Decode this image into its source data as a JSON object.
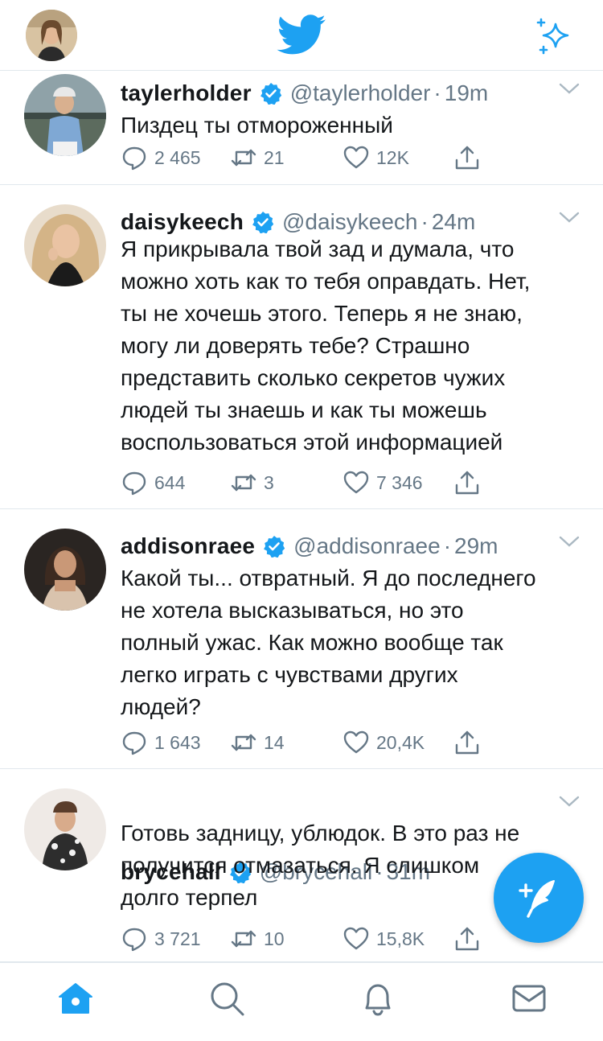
{
  "colors": {
    "accent": "#1da1f2",
    "secondary_text": "#657786",
    "divider": "#e1e8ed"
  },
  "header": {
    "logo_icon": "twitter-bird-icon",
    "sparkle_icon": "sparkle-icon",
    "avatar_icon": "profile-avatar"
  },
  "tweets": [
    {
      "name": "taylerholder",
      "handle": "@taylerholder",
      "time": "19m",
      "text": "Пиздец ты отмороженный",
      "replies": "2 465",
      "retweets": "21",
      "likes": "12K"
    },
    {
      "name": "daisykeech",
      "handle": "@daisykeech",
      "time": "24m",
      "text": "Я прикрывала твой зад и думала, что\nможно хоть как то тебя оправдать. Нет,\nты не хочешь этого. Теперь я не знаю,\nмогу ли доверять тебе? Страшно\nпредставить сколько секретов чужих\nлюдей ты знаешь и как ты можешь\nвоспользоваться этой информацией",
      "replies": "644",
      "retweets": "3",
      "likes": "7 346"
    },
    {
      "name": "addisonraee",
      "handle": "@addisonraee",
      "time": "29m",
      "text": "Какой ты... отвратный. Я до последнего\nне хотела высказываться, но это\nполный ужас. Как можно вообще так\nлегко играть с чувствами других\nлюдей?",
      "replies": "1 643",
      "retweets": "14",
      "likes": "20,4K"
    },
    {
      "name": "brycehall",
      "handle": "@brycehall",
      "time": "31m",
      "text": "Готовь задницу, ублюдок. В это раз не\nполучится отмазаться. Я слишком\nдолго терпел",
      "replies": "3 721",
      "retweets": "10",
      "likes": "15,8K"
    }
  ],
  "fab": {
    "icon": "compose-tweet-icon"
  },
  "tabbar": {
    "icons": [
      "home-icon",
      "search-icon",
      "notifications-bell-icon",
      "messages-envelope-icon"
    ]
  }
}
